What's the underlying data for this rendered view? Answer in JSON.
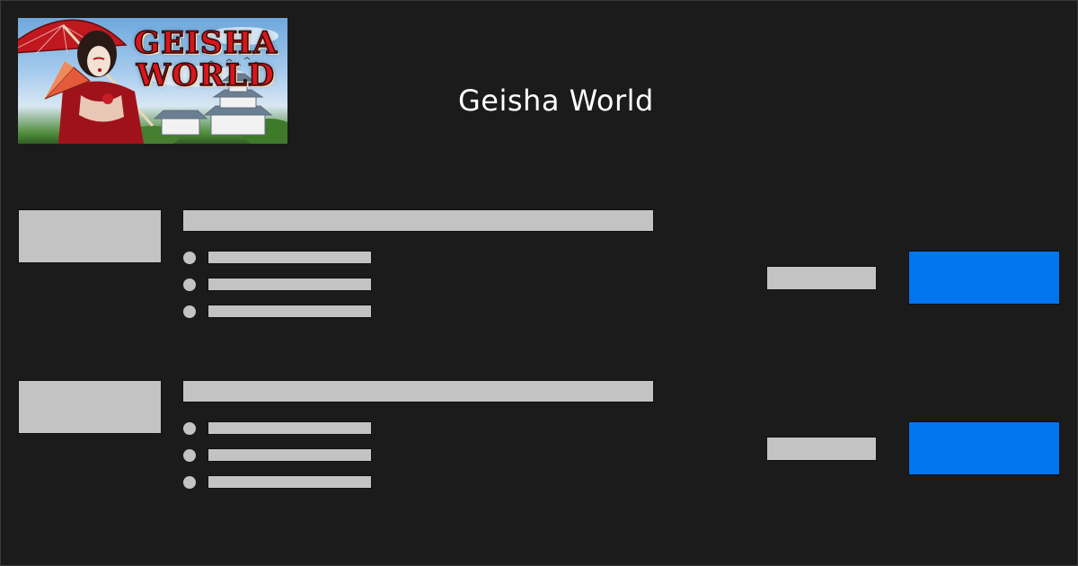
{
  "header": {
    "title": "Geisha World",
    "banner": {
      "logo_text_line1": "GEISHA",
      "logo_text_line2": "WORLD"
    }
  },
  "listings": [
    {
      "thumbnail": "",
      "title": "",
      "features": [
        "",
        "",
        ""
      ],
      "price": "",
      "cta_label": ""
    },
    {
      "thumbnail": "",
      "title": "",
      "features": [
        "",
        "",
        ""
      ],
      "price": "",
      "cta_label": ""
    }
  ],
  "colors": {
    "background": "#1b1b1b",
    "placeholder": "#c3c3c3",
    "cta": "#0076ee",
    "title_text": "#ffffff",
    "logo_red": "#d8161d"
  }
}
